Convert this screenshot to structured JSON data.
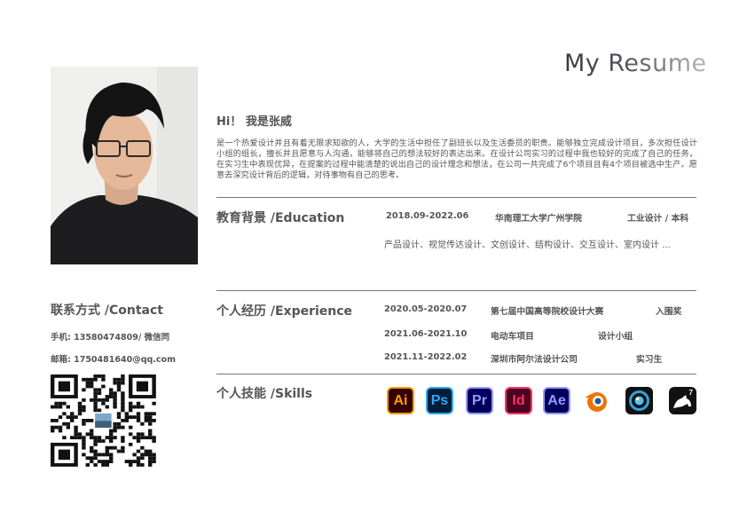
{
  "header": {
    "title": "My Resume"
  },
  "intro": {
    "greeting": "Hi！ 我是张威",
    "bio": "是一个热爱设计并且有着无限求知欲的人，大学的生活中担任了副班长以及生活委员的职责。能够独立完成设计项目，多次担任设计小组的组长，擅长并且愿意与人沟通，能够将自己的想法较好的表达出来。在设计公司实习的过程中我也较好的完成了自己的任务，在实习生中表现优异，在提案的过程中能清楚的说出自己的设计理念和想法，在公司一共完成了6个项目且有4个项目被选中生产。愿意去深究设计背后的逻辑，对待事物有自己的思考。"
  },
  "education": {
    "title": "教育背景 /Education",
    "period": "2018.09-2022.06",
    "school": "华南理工大学广州学院",
    "major": "工业设计 / 本科",
    "courses": "产品设计、视觉传达设计、文创设计、结构设计、交互设计、室内设计 ..."
  },
  "experience": {
    "title": "个人经历 /Experience",
    "items": [
      {
        "period": "2020.05-2020.07",
        "name": "第七届中国高等院校设计大赛",
        "role": "入围奖"
      },
      {
        "period": "2021.06-2021.10",
        "name": "电动车项目",
        "role": "设计小组"
      },
      {
        "period": "2021.11-2022.02",
        "name": "深圳市阿尔法设计公司",
        "role": "实习生"
      }
    ]
  },
  "skills": {
    "title": "个人技能 /Skills",
    "items": [
      {
        "label": "Ai",
        "icon": "illustrator-icon",
        "bg": "#330000",
        "fg": "#ff9a00"
      },
      {
        "label": "Ps",
        "icon": "photoshop-icon",
        "bg": "#001e36",
        "fg": "#31a8ff"
      },
      {
        "label": "Pr",
        "icon": "premiere-icon",
        "bg": "#00005b",
        "fg": "#9999ff"
      },
      {
        "label": "Id",
        "icon": "indesign-icon",
        "bg": "#49021f",
        "fg": "#ff3366"
      },
      {
        "label": "Ae",
        "icon": "after-effects-icon",
        "bg": "#00005b",
        "fg": "#9999ff"
      },
      {
        "label": "",
        "icon": "blender-icon",
        "bg": "#ffffff",
        "fg": "#ea7600"
      },
      {
        "label": "",
        "icon": "keyshot-icon",
        "bg": "#111111",
        "fg": "#2aa7df"
      },
      {
        "label": "7",
        "icon": "rhino-icon",
        "bg": "#111111",
        "fg": "#ffffff"
      }
    ]
  },
  "contact": {
    "title": "联系方式 /Contact",
    "phone": "手机:  13580474809/ 微信同",
    "email": "邮箱:  1750481640@qq.com"
  }
}
